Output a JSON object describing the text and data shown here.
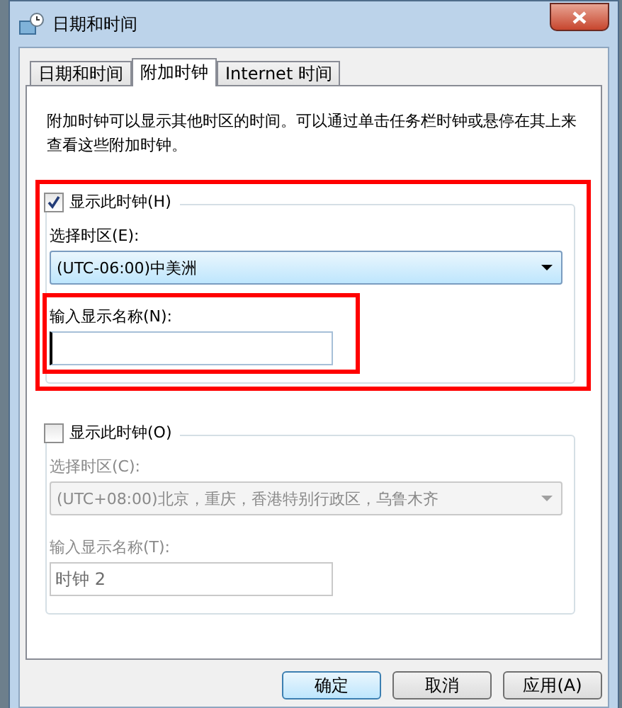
{
  "window": {
    "title": "日期和时间"
  },
  "tabs": [
    {
      "label": "日期和时间",
      "selected": false
    },
    {
      "label": "附加时钟",
      "selected": true
    },
    {
      "label": "Internet 时间",
      "selected": false
    }
  ],
  "description": "附加时钟可以显示其他时区的时间。可以通过单击任务栏时钟或悬停在其上来查看这些附加时钟。",
  "clocks": [
    {
      "show_label": "显示此时钟(H)",
      "checked": true,
      "disabled": false,
      "highlighted": true,
      "timezone_label": "选择时区(E):",
      "timezone": "(UTC-06:00)中美洲",
      "name_label": "输入显示名称(N):",
      "name_highlighted": true,
      "focused": true
    },
    {
      "show_label": "显示此时钟(O)",
      "checked": false,
      "disabled": true,
      "highlighted": false,
      "timezone_label": "选择时区(C):",
      "timezone": "(UTC+08:00)北京，重庆，香港特别行政区，乌鲁木齐",
      "name_label": "输入显示名称(T):",
      "name_value": "时钟 2",
      "name_highlighted": false,
      "focused": false
    }
  ],
  "buttons": [
    {
      "label": "确定",
      "default": true
    },
    {
      "label": "取消",
      "default": false
    },
    {
      "label": "应用(A)",
      "default": false
    }
  ]
}
